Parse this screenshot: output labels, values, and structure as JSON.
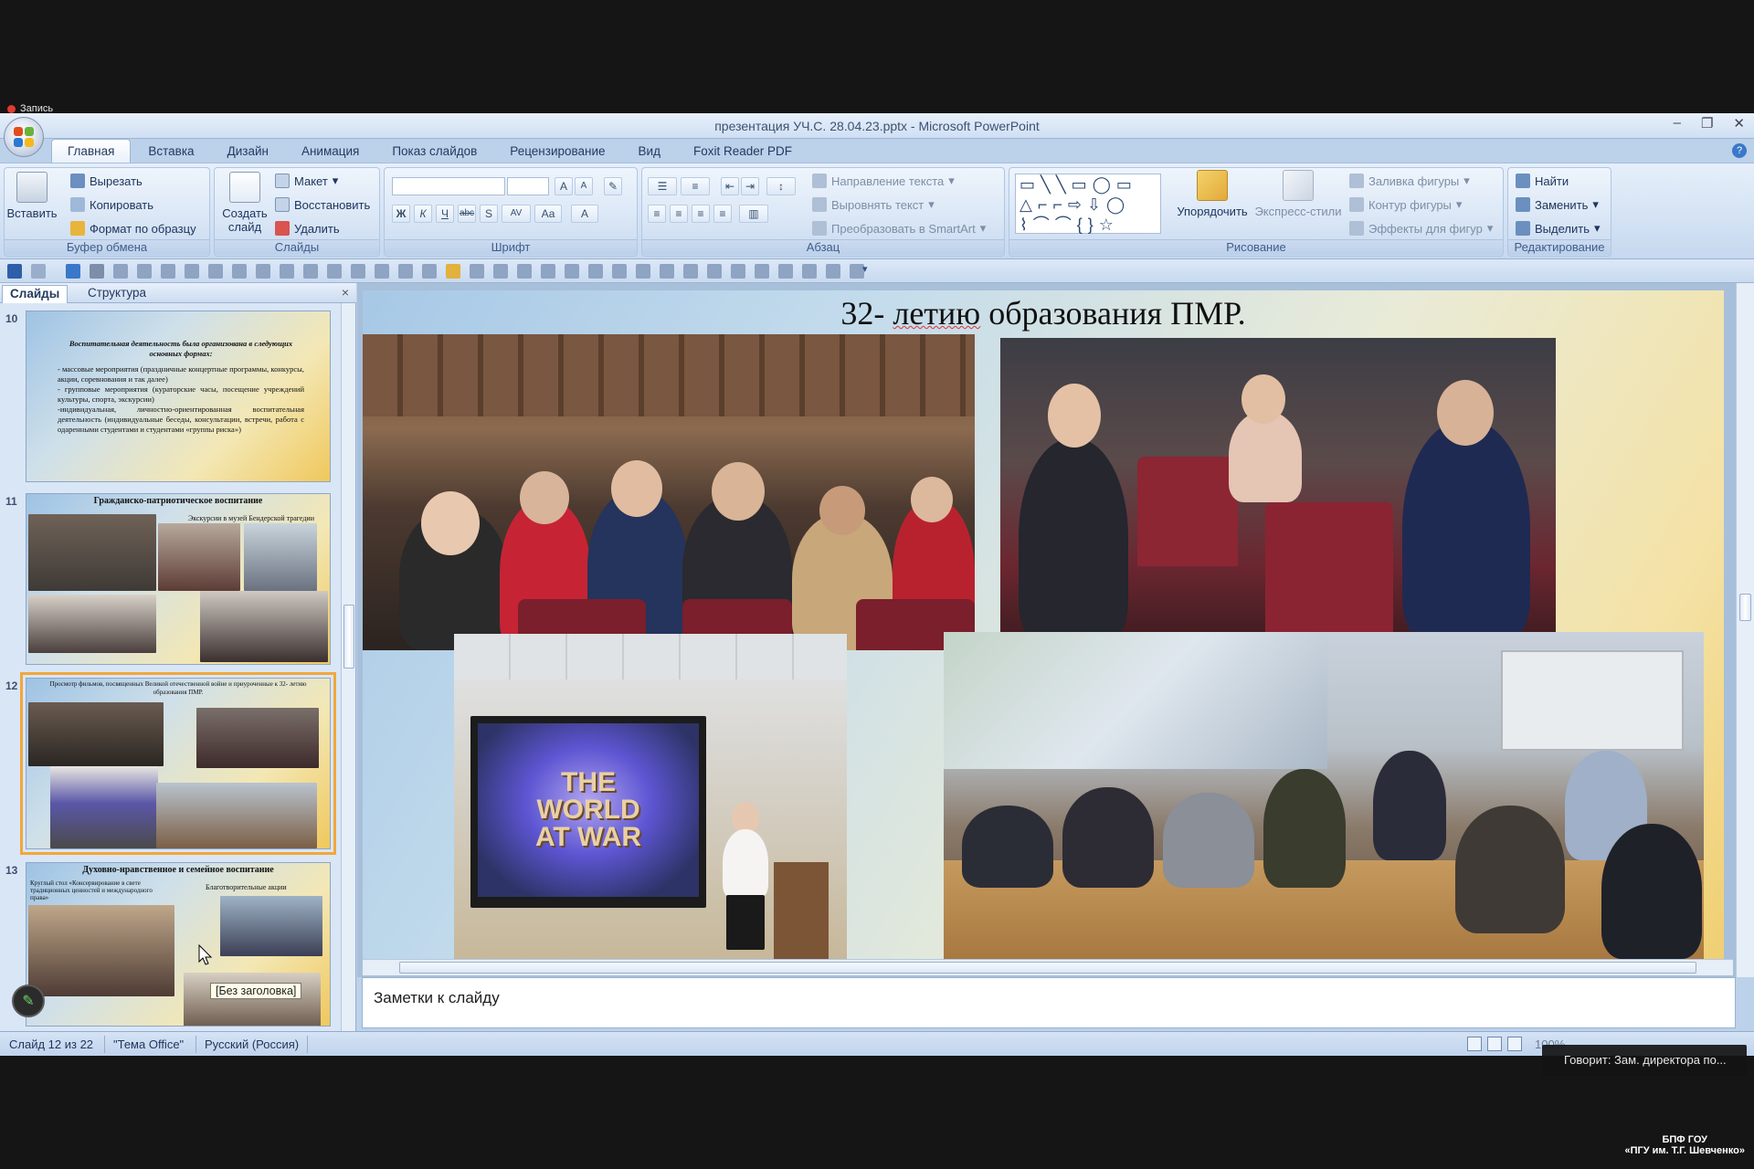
{
  "recording": {
    "label": "Запись"
  },
  "window": {
    "title": "презентация УЧ.С. 28.04.23.pptx - Microsoft PowerPoint",
    "minimize": "–",
    "restore": "❐",
    "close": "✕",
    "help": "?"
  },
  "ribbon_tabs": [
    "Главная",
    "Вставка",
    "Дизайн",
    "Анимация",
    "Показ слайдов",
    "Рецензирование",
    "Вид",
    "Foxit Reader PDF"
  ],
  "ribbon": {
    "clipboard": {
      "label": "Буфер обмена",
      "paste": "Вставить",
      "cut": "Вырезать",
      "copy": "Копировать",
      "format_painter": "Формат по образцу"
    },
    "slides": {
      "label": "Слайды",
      "new_slide": "Создать слайд",
      "layout": "Макет",
      "reset": "Восстановить",
      "delete": "Удалить"
    },
    "font": {
      "label": "Шрифт",
      "bold": "Ж",
      "italic": "К",
      "underline": "Ч",
      "strike": "abc",
      "shadow": "S",
      "spacing": "AV",
      "case": "Аа",
      "color": "A",
      "grow": "A",
      "shrink": "A"
    },
    "paragraph": {
      "label": "Абзац",
      "text_direction": "Направление текста",
      "align_text": "Выровнять текст",
      "smartart": "Преобразовать в SmartArt"
    },
    "drawing": {
      "label": "Рисование",
      "arrange": "Упорядочить",
      "quick_styles": "Экспресс-стили",
      "shape_fill": "Заливка фигуры",
      "shape_outline": "Контур фигуры",
      "shape_effects": "Эффекты для фигур"
    },
    "editing": {
      "label": "Редактирование",
      "find": "Найти",
      "replace": "Заменить",
      "select": "Выделить"
    }
  },
  "panel": {
    "tabs": [
      "Слайды",
      "Структура"
    ],
    "close": "×",
    "slides": [
      {
        "number": "10",
        "text_lines": [
          "Воспитательная деятельность была организована в следующих основных формах:",
          "- массовые мероприятия (праздничные концертные программы, конкурсы, акции, соревнования и так далее)",
          "- групповые мероприятия (кураторские часы, посещение учреждений культуры, спорта, экскурсии)",
          "-индивидуальная, личностно-ориентированная воспитательная деятельность (индивидуальные беседы, консультации, встречи, работа с одаренными студентами и студентами «группы риска»)"
        ]
      },
      {
        "number": "11",
        "title": "Гражданско-патриотическое воспитание",
        "subtitle": "Экскурсии в музей Бендерской трагедии"
      },
      {
        "number": "12",
        "title": "Просмотр фильмов, посвященных Великой отечественной войне и приуроченные к 32- летию образования ПМР."
      },
      {
        "number": "13",
        "title": "Духовно-нравственное и семейное воспитание",
        "left_caption": "Круглый стол «Консервирование в свете традиционных ценностей и международного права»",
        "right_caption": "Благотворительные акции"
      }
    ]
  },
  "tooltip": "[Без заголовка]",
  "slide": {
    "title_prefix": "32- ",
    "title_underlined": "летию",
    "title_suffix": " образования ПМР.",
    "screen_text": "THE WORLD AT WAR"
  },
  "notes_placeholder": "Заметки к слайду",
  "status": {
    "slide": "Слайд 12 из 22",
    "theme": "\"Тема Office\"",
    "language": "Русский (Россия)",
    "zoom": "100%"
  },
  "speaker": "Говорит: Зам. директора по...",
  "org": {
    "line1": "БПФ ГОУ",
    "line2": "«ПГУ им. Т.Г. Шевченко»"
  },
  "colors": {
    "accent": "#f2a73a",
    "ribbon": "#d3e2f4",
    "seat": "#7a1f2b"
  }
}
